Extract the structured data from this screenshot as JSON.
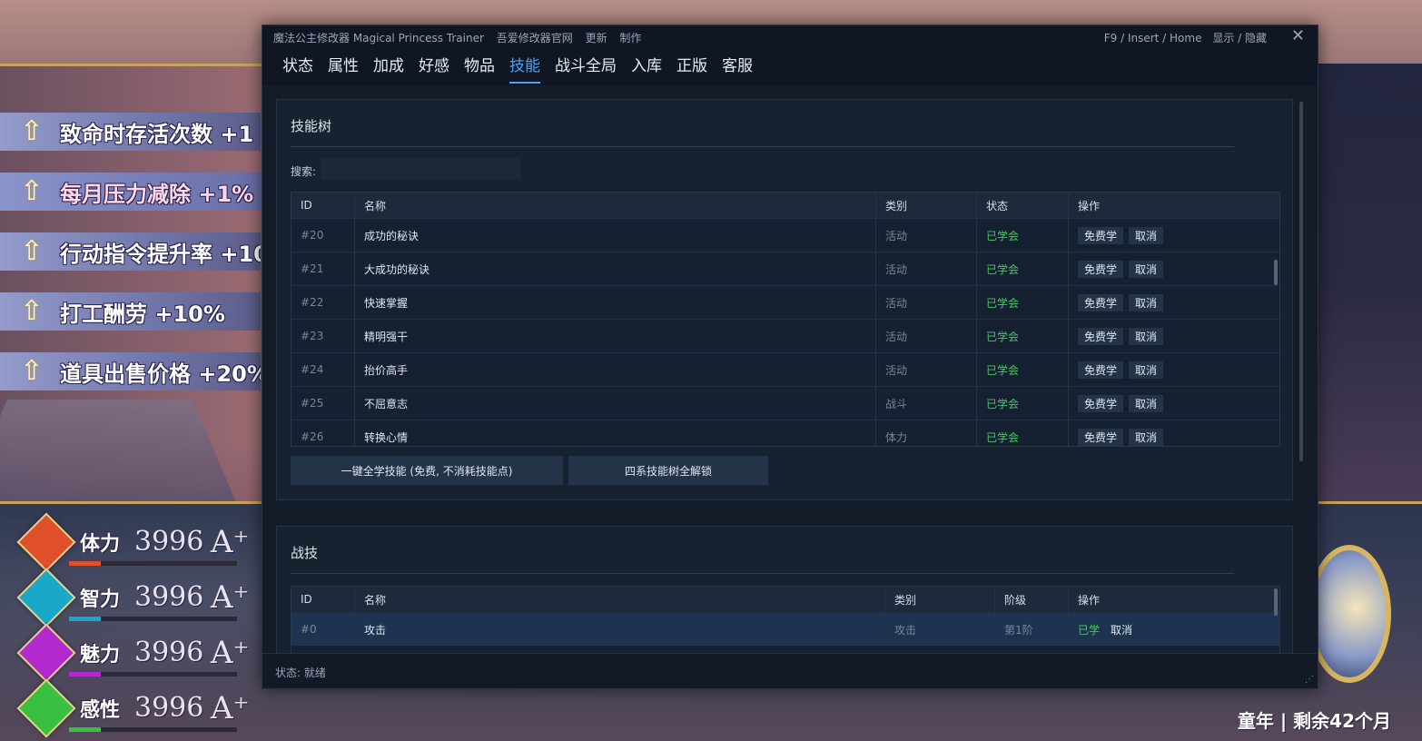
{
  "buffs": [
    {
      "label": "致命时存活次数 +1"
    },
    {
      "label": "每月压力减除 +1%"
    },
    {
      "label": "行动指令提升率 +10"
    },
    {
      "label": "打工酬劳 +10%"
    },
    {
      "label": "道具出售价格 +20%"
    }
  ],
  "stats": [
    {
      "name": "体力",
      "value": "3996",
      "grade": "A⁺",
      "color": "#e0502a",
      "bar": 0.19
    },
    {
      "name": "智力",
      "value": "3996",
      "grade": "A⁺",
      "color": "#1aa8c8",
      "bar": 0.19
    },
    {
      "name": "魅力",
      "value": "3996",
      "grade": "A⁺",
      "color": "#b02ad0",
      "bar": 0.19
    },
    {
      "name": "感性",
      "value": "3996",
      "grade": "A⁺",
      "color": "#3ac040",
      "bar": 0.19
    }
  ],
  "age_text": "童年 | 剩余42个月",
  "window": {
    "title": "魔法公主修改器 Magical Princess Trainer",
    "title_links": [
      "吾爱修改器官网",
      "更新",
      "制作"
    ],
    "hotkeys": "F9 / Insert / Home",
    "toggle": "显示 / 隐藏",
    "close": "✕"
  },
  "tabs": [
    "状态",
    "属性",
    "加成",
    "好感",
    "物品",
    "技能",
    "战斗全局",
    "入库",
    "正版",
    "客服"
  ],
  "active_tab": "技能",
  "skill_tree": {
    "title": "技能树",
    "search_label": "搜索:",
    "search_value": "",
    "headers": {
      "id": "ID",
      "name": "名称",
      "category": "类别",
      "state": "状态",
      "op": "操作"
    },
    "rows": [
      {
        "id": "#20",
        "name": "成功的秘诀",
        "category": "活动",
        "state": "已学会",
        "btn1": "免费学",
        "btn2": "取消"
      },
      {
        "id": "#21",
        "name": "大成功的秘诀",
        "category": "活动",
        "state": "已学会",
        "btn1": "免费学",
        "btn2": "取消"
      },
      {
        "id": "#22",
        "name": "快速掌握",
        "category": "活动",
        "state": "已学会",
        "btn1": "免费学",
        "btn2": "取消"
      },
      {
        "id": "#23",
        "name": "精明强干",
        "category": "活动",
        "state": "已学会",
        "btn1": "免费学",
        "btn2": "取消"
      },
      {
        "id": "#24",
        "name": "抬价高手",
        "category": "活动",
        "state": "已学会",
        "btn1": "免费学",
        "btn2": "取消"
      },
      {
        "id": "#25",
        "name": "不屈意志",
        "category": "战斗",
        "state": "已学会",
        "btn1": "免费学",
        "btn2": "取消"
      },
      {
        "id": "#26",
        "name": "转换心情",
        "category": "体力",
        "state": "已学会",
        "btn1": "免费学",
        "btn2": "取消"
      }
    ],
    "learn_all": "一键全学技能 (免费, 不消耗技能点)",
    "unlock_all": "四系技能树全解锁"
  },
  "combat": {
    "title": "战技",
    "headers": {
      "id": "ID",
      "name": "名称",
      "category": "类别",
      "tier": "阶级",
      "op": "操作"
    },
    "rows": [
      {
        "id": "#0",
        "name": "攻击",
        "category": "攻击",
        "tier": "第1阶",
        "state": "已学",
        "btn": "取消"
      }
    ]
  },
  "status": "状态: 就绪"
}
